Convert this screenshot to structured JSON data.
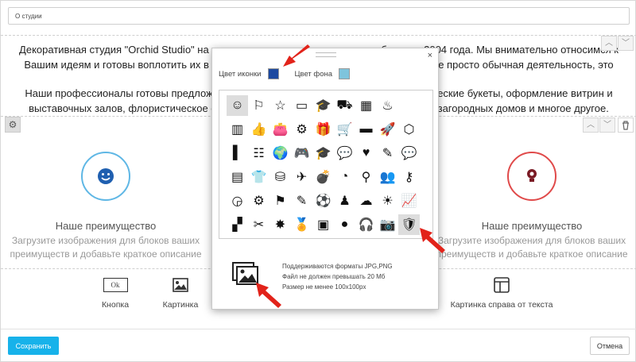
{
  "editor": {
    "title_value": "О студии",
    "paragraph1_line1": "Декоративная студия \"Orchid Studio\" на рынке цветочных услуг успешно работает с 2004 года. Мы внимательно относимся к",
    "paragraph1_line2": "Вашим идеям и готовы воплотить их в реальность. Для нас работа с цветами — это не просто обычная деятельность, это",
    "paragraph2_line1": "Наши профессионалы готовы предложить Вам свадебные и праздничные флористические букеты, оформление витрин и",
    "paragraph2_line2": "выставочных залов, флористическое оформление интерьеров офисов, ресторанов, загородных домов и многое другое."
  },
  "advantages": [
    {
      "title": "Наше преимущество",
      "desc_line1": "Загрузите изображения для блоков ваших",
      "desc_line2": "преимуществ и добавьте краткое описание",
      "icon": "smile-icon",
      "color": "#3a9ad9"
    },
    {
      "title": "Наше преимущество",
      "desc_line1": "Загрузите изображения для блоков ваших",
      "desc_line2": "преимуществ и добавьте краткое описание",
      "icon": "lightbulb-icon",
      "color": "#d8333a"
    }
  ],
  "block_types": [
    {
      "label": "Кнопка",
      "icon_text": "Ok"
    },
    {
      "label": "Картинка"
    },
    {
      "label": "Картинка справа от текста"
    }
  ],
  "modal": {
    "icon_color_label": "Цвет иконки",
    "bg_color_label": "Цвет фона",
    "icon_color": "#1e4aa0",
    "bg_color": "#7ec4dc",
    "close_glyph": "×",
    "upload_info": [
      "Поддерживаются форматы JPG,PNG",
      "Файл не должен превышать 20 Мб",
      "Размер не менее 100x100px"
    ],
    "icons": [
      [
        "☺",
        "⚐",
        "☆",
        "▭",
        "🎓",
        "⛟",
        "▦",
        "♨"
      ],
      [
        "▥",
        "👍",
        "👛",
        "⚙",
        "🎁",
        "🛒",
        "▬",
        "🚀",
        "⬡"
      ],
      [
        "▌",
        "☷",
        "🌍",
        "🎮",
        "🎓",
        "💬",
        "♥",
        "✎",
        "💬"
      ],
      [
        "▤",
        "👕",
        "⛁",
        "✈",
        "💣",
        "◔",
        "⚲",
        "👥",
        "⚷"
      ],
      [
        "◶",
        "⚙",
        "⚑",
        "✎",
        "⚽",
        "♟",
        "☁",
        "☀",
        "📈"
      ],
      [
        "▞",
        "✂",
        "✸",
        "🏅",
        "▣",
        "●",
        "🎧",
        "📷",
        "🛡"
      ]
    ]
  },
  "footer": {
    "save": "Сохранить",
    "cancel": "Отмена"
  }
}
